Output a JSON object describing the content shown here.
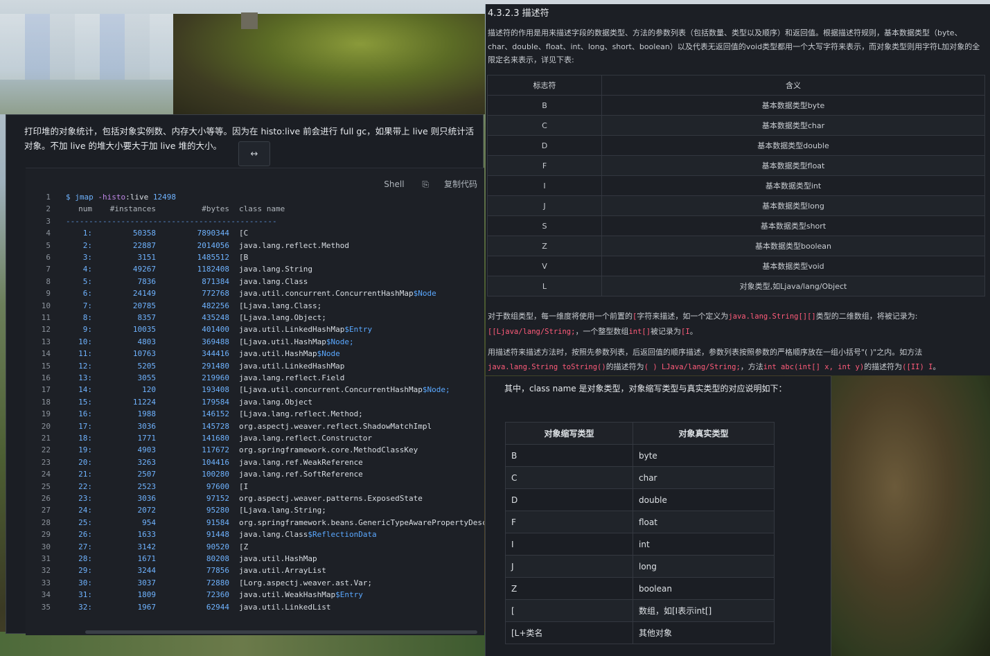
{
  "left": {
    "intro": "打印堆的对象统计，包括对象实例数、内存大小等等。因为在 histo:live 前会进行 full gc，如果带上 live 则只统计活对象。不加 live 的堆大小要大于加 live 堆的大小。",
    "expand_icon": "↔",
    "code_lang": "Shell",
    "copy_label": "复制代码",
    "command": {
      "prompt": "$",
      "cmd": "jmap",
      "opt": "-histo",
      "opt_rest": ":live",
      "pid": "12498"
    },
    "header": {
      "num": "num",
      "instances": "#instances",
      "bytes": "#bytes",
      "class_name": "class name"
    },
    "separator": "----------------------------------------------",
    "rows": [
      {
        "num": "1:",
        "inst": "50358",
        "bytes": "7890344",
        "cls": "[C",
        "acc": ""
      },
      {
        "num": "2:",
        "inst": "22887",
        "bytes": "2014056",
        "cls": "java.lang.reflect.Method",
        "acc": ""
      },
      {
        "num": "3:",
        "inst": "3151",
        "bytes": "1485512",
        "cls": "[B",
        "acc": ""
      },
      {
        "num": "4:",
        "inst": "49267",
        "bytes": "1182408",
        "cls": "java.lang.String",
        "acc": ""
      },
      {
        "num": "5:",
        "inst": "7836",
        "bytes": "871384",
        "cls": "java.lang.Class",
        "acc": ""
      },
      {
        "num": "6:",
        "inst": "24149",
        "bytes": "772768",
        "cls": "java.util.concurrent.ConcurrentHashMap",
        "acc": "$Node"
      },
      {
        "num": "7:",
        "inst": "20785",
        "bytes": "482256",
        "cls": "[Ljava.lang.Class;",
        "acc": ""
      },
      {
        "num": "8:",
        "inst": "8357",
        "bytes": "435248",
        "cls": "[Ljava.lang.Object;",
        "acc": ""
      },
      {
        "num": "9:",
        "inst": "10035",
        "bytes": "401400",
        "cls": "java.util.LinkedHashMap",
        "acc": "$Entry"
      },
      {
        "num": "10:",
        "inst": "4803",
        "bytes": "369488",
        "cls": "[Ljava.util.HashMap",
        "acc": "$Node;"
      },
      {
        "num": "11:",
        "inst": "10763",
        "bytes": "344416",
        "cls": "java.util.HashMap",
        "acc": "$Node"
      },
      {
        "num": "12:",
        "inst": "5205",
        "bytes": "291480",
        "cls": "java.util.LinkedHashMap",
        "acc": ""
      },
      {
        "num": "13:",
        "inst": "3055",
        "bytes": "219960",
        "cls": "java.lang.reflect.Field",
        "acc": ""
      },
      {
        "num": "14:",
        "inst": "120",
        "bytes": "193408",
        "cls": "[Ljava.util.concurrent.ConcurrentHashMap",
        "acc": "$Node;"
      },
      {
        "num": "15:",
        "inst": "11224",
        "bytes": "179584",
        "cls": "java.lang.Object",
        "acc": ""
      },
      {
        "num": "16:",
        "inst": "1988",
        "bytes": "146152",
        "cls": "[Ljava.lang.reflect.Method;",
        "acc": ""
      },
      {
        "num": "17:",
        "inst": "3036",
        "bytes": "145728",
        "cls": "org.aspectj.weaver.reflect.ShadowMatchImpl",
        "acc": ""
      },
      {
        "num": "18:",
        "inst": "1771",
        "bytes": "141680",
        "cls": "java.lang.reflect.Constructor",
        "acc": ""
      },
      {
        "num": "19:",
        "inst": "4903",
        "bytes": "117672",
        "cls": "org.springframework.core.MethodClassKey",
        "acc": ""
      },
      {
        "num": "20:",
        "inst": "3263",
        "bytes": "104416",
        "cls": "java.lang.ref.WeakReference",
        "acc": ""
      },
      {
        "num": "21:",
        "inst": "2507",
        "bytes": "100280",
        "cls": "java.lang.ref.SoftReference",
        "acc": ""
      },
      {
        "num": "22:",
        "inst": "2523",
        "bytes": "97600",
        "cls": "[I",
        "acc": ""
      },
      {
        "num": "23:",
        "inst": "3036",
        "bytes": "97152",
        "cls": "org.aspectj.weaver.patterns.ExposedState",
        "acc": ""
      },
      {
        "num": "24:",
        "inst": "2072",
        "bytes": "95280",
        "cls": "[Ljava.lang.String;",
        "acc": ""
      },
      {
        "num": "25:",
        "inst": "954",
        "bytes": "91584",
        "cls": "org.springframework.beans.GenericTypeAwarePropertyDescr",
        "acc": ""
      },
      {
        "num": "26:",
        "inst": "1633",
        "bytes": "91448",
        "cls": "java.lang.Class",
        "acc": "$ReflectionData"
      },
      {
        "num": "27:",
        "inst": "3142",
        "bytes": "90520",
        "cls": "[Z",
        "acc": ""
      },
      {
        "num": "28:",
        "inst": "1671",
        "bytes": "80208",
        "cls": "java.util.HashMap",
        "acc": ""
      },
      {
        "num": "29:",
        "inst": "3244",
        "bytes": "77856",
        "cls": "java.util.ArrayList",
        "acc": ""
      },
      {
        "num": "30:",
        "inst": "3037",
        "bytes": "72880",
        "cls": "[Lorg.aspectj.weaver.ast.Var;",
        "acc": ""
      },
      {
        "num": "31:",
        "inst": "1809",
        "bytes": "72360",
        "cls": "java.util.WeakHashMap",
        "acc": "$Entry"
      },
      {
        "num": "32:",
        "inst": "1967",
        "bytes": "62944",
        "cls": "java.util.LinkedList",
        "acc": ""
      }
    ]
  },
  "right_top": {
    "title": "4.3.2.3 描述符",
    "paragraph": "描述符的作用是用来描述字段的数据类型、方法的参数列表（包括数量、类型以及顺序）和返回值。根据描述符规则，基本数据类型（byte、char、double、float、int、long、short、boolean）以及代表无返回值的void类型都用一个大写字符来表示，而对象类型则用字符L加对象的全限定名来表示，详见下表:",
    "headers": [
      "标志符",
      "含义"
    ],
    "rows": [
      [
        "B",
        "基本数据类型byte"
      ],
      [
        "C",
        "基本数据类型char"
      ],
      [
        "D",
        "基本数据类型double"
      ],
      [
        "F",
        "基本数据类型float"
      ],
      [
        "I",
        "基本数据类型int"
      ],
      [
        "J",
        "基本数据类型long"
      ],
      [
        "S",
        "基本数据类型short"
      ],
      [
        "Z",
        "基本数据类型boolean"
      ],
      [
        "V",
        "基本数据类型void"
      ],
      [
        "L",
        "对象类型,如Ljava/lang/Object"
      ]
    ],
    "note1": {
      "t1": "对于数组类型，每一维度将使用一个前置的",
      "c1": "[",
      "t2": "字符来描述，如一个定义为",
      "c2": "java.lang.String[][]",
      "t3": "类型的二维数组，将被记录为:",
      "c3": "[[Ljava/lang/String;",
      "t4": "，一个整型数组",
      "c4": "int[]",
      "t5": "被记录为",
      "c5": "[I",
      "t6": "。"
    },
    "note2": {
      "t1": "用描述符来描述方法时，按照先参数列表，后返回值的顺序描述，参数列表按照参数的严格顺序放在一组小括号\"( )\"之内。如方法",
      "c1": "java.lang.String toString()",
      "t2": "的描述符为",
      "c2": "( ) LJava/lang/String;",
      "t3": "，方法",
      "c3": "int abc(int[] x, int y)",
      "t4": "的描述符为",
      "c4": "([II) I",
      "t5": "。"
    }
  },
  "right_bottom": {
    "intro": "其中，class name 是对象类型，对象缩写类型与真实类型的对应说明如下：",
    "headers": [
      "对象缩写类型",
      "对象真实类型"
    ],
    "rows": [
      [
        "B",
        "byte"
      ],
      [
        "C",
        "char"
      ],
      [
        "D",
        "double"
      ],
      [
        "F",
        "float"
      ],
      [
        "I",
        "int"
      ],
      [
        "J",
        "long"
      ],
      [
        "Z",
        "boolean"
      ],
      [
        "[",
        "数组，如[I表示int[]"
      ],
      [
        "[L+类名",
        "其他对象"
      ]
    ]
  }
}
